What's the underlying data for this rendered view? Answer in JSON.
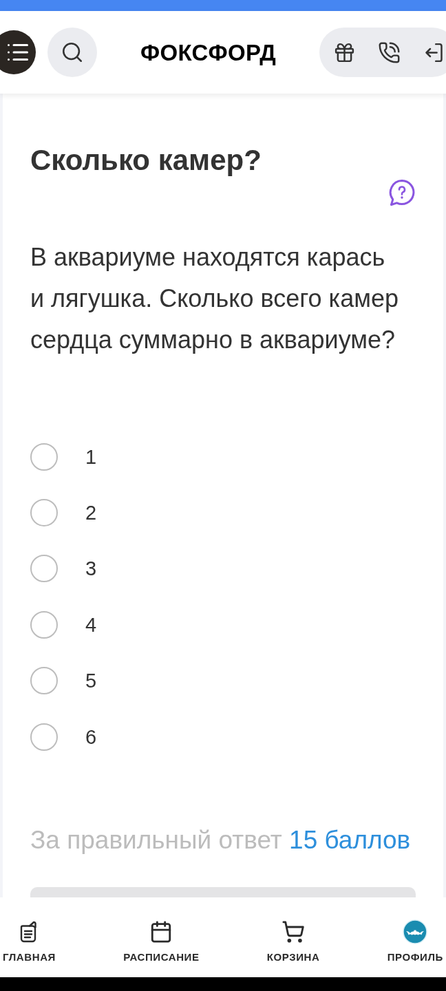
{
  "header": {
    "logo": "ФОКСФОРД"
  },
  "task": {
    "title": "Сколько камер?",
    "question": "В аквариуме находятся карась и лягушка. Сколько всего камер сердца суммарно в аквариуме?",
    "options": [
      {
        "label": "1",
        "selected": false
      },
      {
        "label": "2",
        "selected": false
      },
      {
        "label": "3",
        "selected": false
      },
      {
        "label": "4",
        "selected": false
      },
      {
        "label": "5",
        "selected": false
      },
      {
        "label": "6",
        "selected": false
      }
    ],
    "reward": {
      "text": "За правильный ответ",
      "points": "15 баллов"
    }
  },
  "bottom_nav": [
    {
      "label": "ГЛАВНАЯ",
      "kind": "document"
    },
    {
      "label": "РАСПИСАНИЕ",
      "kind": "calendar"
    },
    {
      "label": "КОРЗИНА",
      "kind": "cart"
    },
    {
      "label": "ПРОФИЛЬ",
      "kind": "avatar"
    }
  ]
}
